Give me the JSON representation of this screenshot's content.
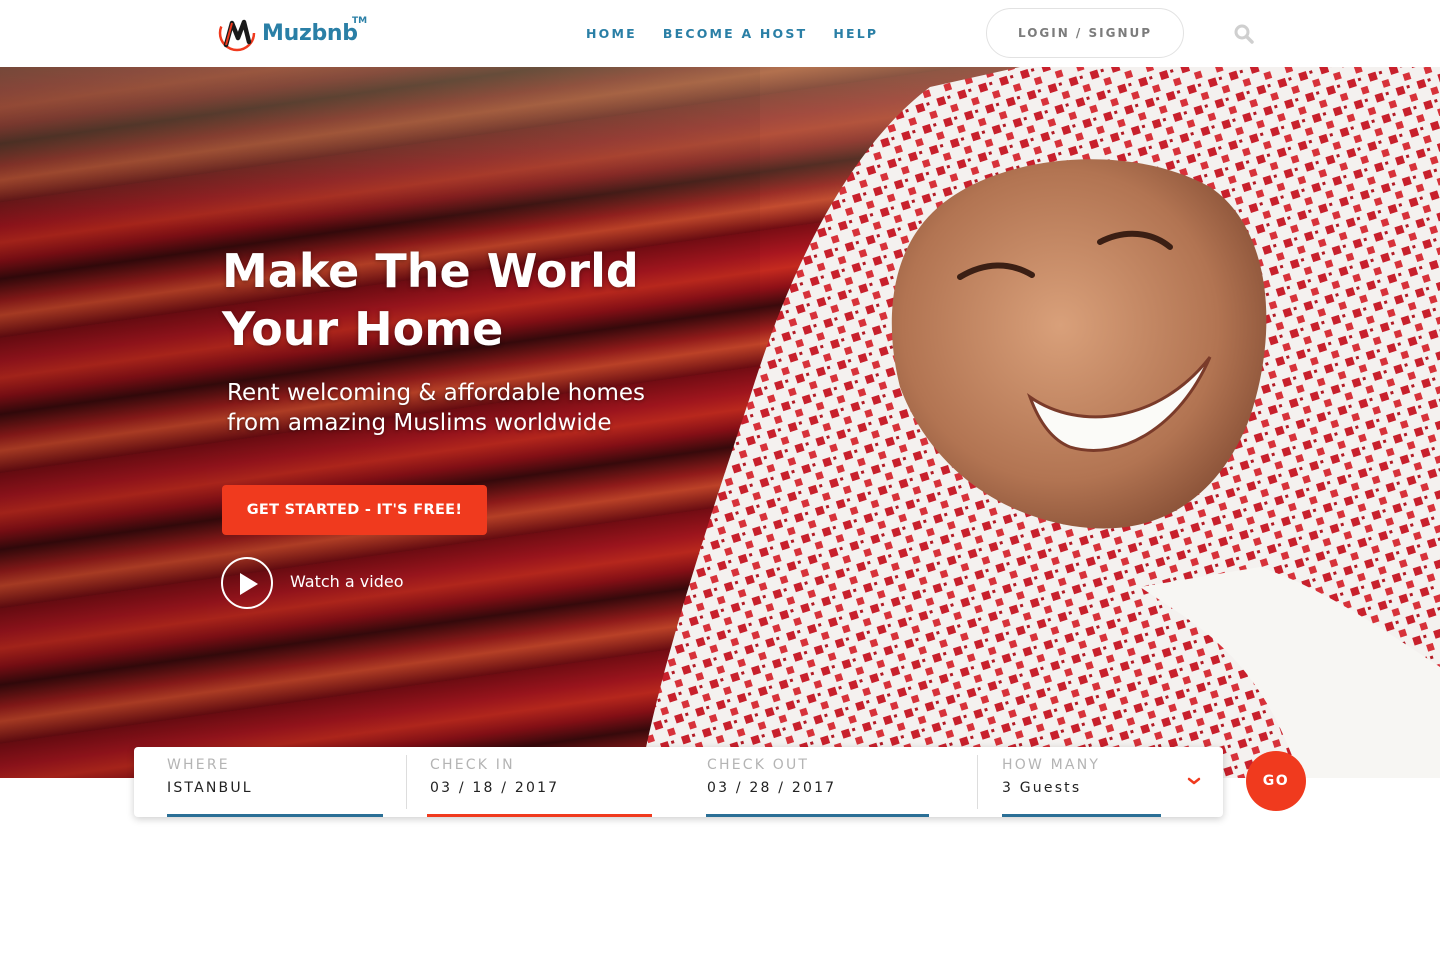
{
  "brand": {
    "name": "Muzbnb",
    "trademark": "TM"
  },
  "nav": {
    "items": [
      "HOME",
      "BECOME A HOST",
      "HELP"
    ]
  },
  "header": {
    "login_label": "LOGIN / SIGNUP"
  },
  "hero": {
    "title_line1": "Make The World",
    "title_line2": "Your Home",
    "subtitle_line1": "Rent welcoming & affordable homes",
    "subtitle_line2": "from amazing Muslims worldwide",
    "cta_label": "GET STARTED - IT'S FREE!",
    "video_label": "Watch a video"
  },
  "search": {
    "where": {
      "label": "WHERE",
      "value": "ISTANBUL"
    },
    "check_in": {
      "label": "CHECK IN",
      "value": "03 / 18 / 2017"
    },
    "check_out": {
      "label": "CHECK OUT",
      "value": "03 / 28 / 2017"
    },
    "guests": {
      "label": "HOW MANY",
      "value": "3 Guests"
    },
    "go_label": "GO"
  },
  "colors": {
    "accent": "#f03a1e",
    "brand": "#2a7fa6",
    "underline": "#2a6f96"
  },
  "icons": {
    "search": "search-icon",
    "play": "play-icon",
    "dropdown": "chevron-down-icon"
  }
}
